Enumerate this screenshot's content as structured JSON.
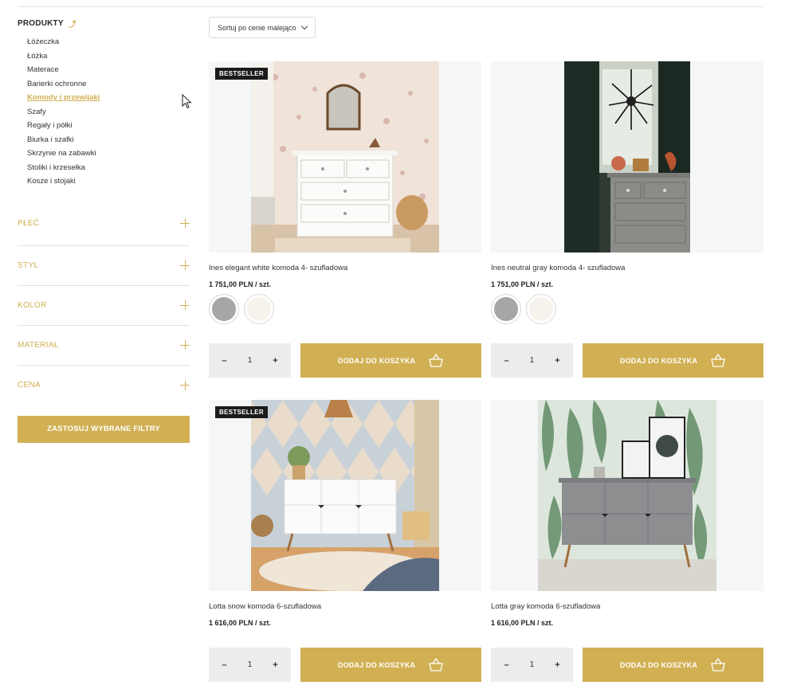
{
  "sidebar": {
    "category_title": "PRODUKTY",
    "categories": [
      "Łóżeczka",
      "Łóżka",
      "Materace",
      "Barierki ochronne",
      "Komody i przewijaki",
      "Szafy",
      "Regały i półki",
      "Biurka i szafki",
      "Skrzynie na zabawki",
      "Stoliki i krzesełka",
      "Kosze i stojaki"
    ],
    "active_category": "Komody i przewijaki",
    "filters": [
      "PŁEĆ",
      "STYL",
      "KOLOR",
      "MATERIAŁ",
      "CENA"
    ],
    "apply_label": "ZASTOSUJ WYBRANE FILTRY"
  },
  "sort": {
    "label": "Sortuj po cenie malejąco"
  },
  "products": [
    {
      "name": "Ines elegant white komoda 4- szufladowa",
      "price": "1 751,00 PLN / szt.",
      "badge": "BESTSELLER",
      "swatches": [
        "#a6a6a4",
        "#f7f3ec"
      ],
      "qty": "1",
      "add_label": "DODAJ DO KOSZYKA"
    },
    {
      "name": "Ines neutral gray komoda 4- szufladowa",
      "price": "1 751,00 PLN / szt.",
      "badge": "",
      "swatches": [
        "#a6a6a4",
        "#f7f3ec"
      ],
      "qty": "1",
      "add_label": "DODAJ DO KOSZYKA"
    },
    {
      "name": "Lotta snow komoda 6-szufladowa",
      "price": "1 616,00 PLN / szt.",
      "badge": "BESTSELLER",
      "qty": "1",
      "add_label": "DODAJ DO KOSZYKA"
    },
    {
      "name": "Lotta gray komoda 6-szufladowa",
      "price": "1 616,00 PLN / szt.",
      "badge": "",
      "qty": "1",
      "add_label": "DODAJ DO KOSZYKA"
    }
  ],
  "qty_controls": {
    "minus": "–",
    "plus": "+"
  },
  "colors": {
    "accent": "#d1b054",
    "badge_bg": "#1b1b1b",
    "qty_bg": "#ececec"
  }
}
